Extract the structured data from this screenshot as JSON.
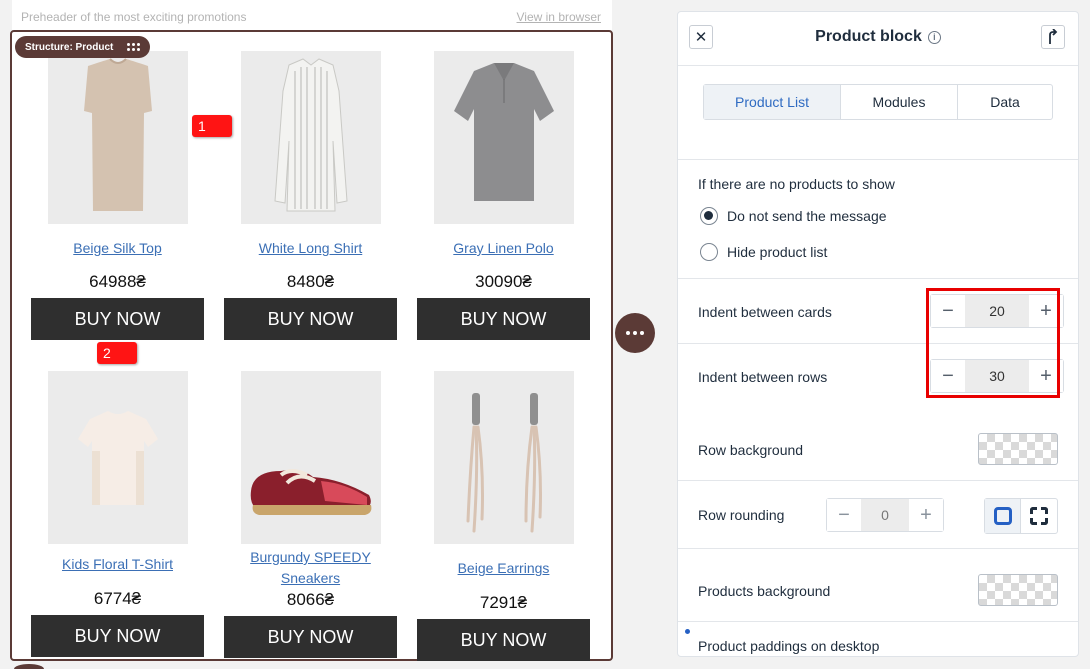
{
  "email": {
    "preheader": "Preheader of the most exciting promotions",
    "view_in_browser": "View in browser",
    "structure_tag": "Structure: Product",
    "markers": [
      "1",
      "2"
    ],
    "products": [
      {
        "name": "Beige Silk Top",
        "price": "64988₴",
        "button": "BUY NOW",
        "image": "beige-sleeveless-top"
      },
      {
        "name": "White Long Shirt",
        "price": "8480₴",
        "button": "BUY NOW",
        "image": "white-striped-shirt"
      },
      {
        "name": "Gray Linen Polo",
        "price": "30090₴",
        "button": "BUY NOW",
        "image": "gray-polo"
      },
      {
        "name": "Kids Floral T-Shirt",
        "price": "6774₴",
        "button": "BUY NOW",
        "image": "kids-tshirt"
      },
      {
        "name": "Burgundy SPEEDY Sneakers",
        "price": "8066₴",
        "button": "BUY NOW",
        "image": "burgundy-sneaker"
      },
      {
        "name": "Beige Earrings",
        "price": "7291₴",
        "button": "BUY NOW",
        "image": "beige-earrings"
      }
    ]
  },
  "panel": {
    "title": "Product block",
    "tabs": [
      {
        "label": "Product List",
        "active": true
      },
      {
        "label": "Modules",
        "active": false
      },
      {
        "label": "Data",
        "active": false
      }
    ],
    "no_products": {
      "label": "If there are no products to show",
      "options": [
        {
          "label": "Do not send the message",
          "checked": true
        },
        {
          "label": "Hide product list",
          "checked": false
        }
      ]
    },
    "indent_cards": {
      "label": "Indent between cards",
      "value": "20"
    },
    "indent_rows": {
      "label": "Indent between rows",
      "value": "30"
    },
    "row_background": {
      "label": "Row background"
    },
    "row_rounding": {
      "label": "Row rounding",
      "value": "0"
    },
    "products_background": {
      "label": "Products background"
    },
    "paddings_desktop": {
      "label": "Product paddings on desktop"
    }
  },
  "colors": {
    "accent": "#2f6bc2",
    "brand": "#5b3a36",
    "button": "#2f2f2f",
    "highlight": "#e80000"
  }
}
